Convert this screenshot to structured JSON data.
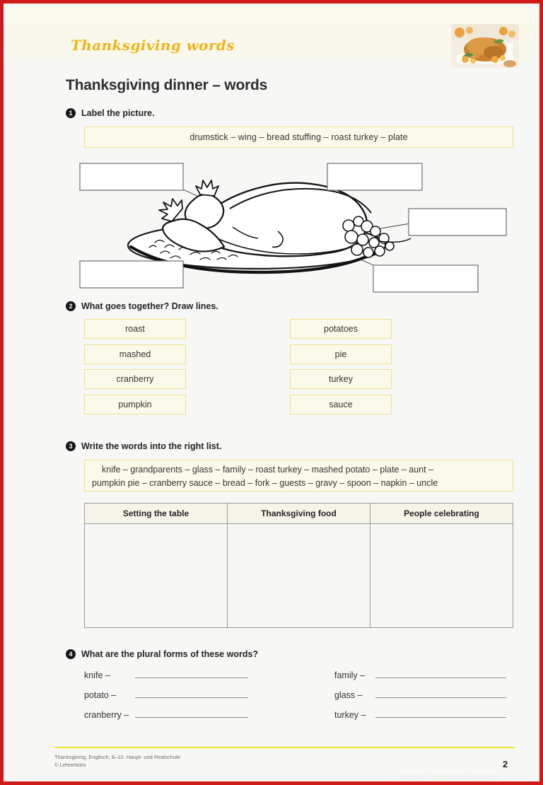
{
  "header": {
    "banner_title": "Thanksgiving words",
    "photo_alt": "roast-turkey-photo",
    "band_color": "#faf8ec",
    "title_color": "#f0b417"
  },
  "page_title": "Thanksgiving dinner – words",
  "border_color": "#d01a1a",
  "exercises": [
    {
      "number": "1",
      "instruction": "Label the picture.",
      "wordbank": "drumstick  –  wing  –  bread stuffing  –  roast turkey  –  plate",
      "wordbank_items": [
        "drumstick",
        "wing",
        "bread stuffing",
        "roast turkey",
        "plate"
      ],
      "label_boxes": [
        "",
        "",
        "",
        "",
        ""
      ]
    },
    {
      "number": "2",
      "instruction": "What goes together? Draw lines.",
      "left_column": [
        "roast",
        "mashed",
        "cranberry",
        "pumpkin"
      ],
      "right_column": [
        "potatoes",
        "pie",
        "turkey",
        "sauce"
      ]
    },
    {
      "number": "3",
      "instruction": "Write the words into the right list.",
      "wordbank_line1": "knife  – grandparents – glass – family – roast turkey – mashed potato – plate – aunt –",
      "wordbank_line2": "pumpkin pie – cranberry sauce – bread – fork – guests – gravy – spoon – napkin – uncle",
      "table_headers": [
        "Setting the table",
        "Thanksgiving food",
        "People celebrating"
      ],
      "table_rows": [
        [
          "",
          "",
          ""
        ]
      ]
    },
    {
      "number": "4",
      "instruction": "What are the plural forms of these words?",
      "left_items": [
        "knife –",
        "potato –",
        "cranberry –"
      ],
      "right_items": [
        "family –",
        "glass –",
        "turkey –"
      ]
    }
  ],
  "footer": {
    "line1": "Thanksgiving, Englisch, 8–10. Haupt- und Realschule",
    "line2": "© Lehrerbüro",
    "page_number": "2",
    "watermark": "Arbeitsblatt Thanksgiving Grundschule",
    "rule_color": "#f2e52e"
  }
}
